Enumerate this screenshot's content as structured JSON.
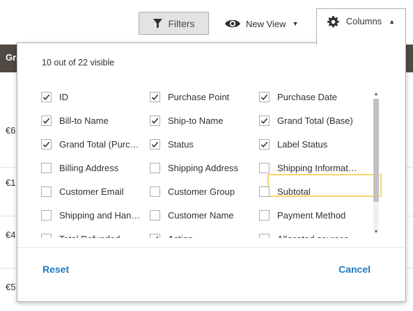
{
  "toolbar": {
    "filters_label": "Filters",
    "view_label": "New View",
    "columns_label": "Columns"
  },
  "grid": {
    "header_label": "Grand T",
    "rows": [
      "€6",
      "€1",
      "€4",
      "€5"
    ]
  },
  "popup": {
    "count_text": "10 out of 22 visible",
    "columns": [
      {
        "label": "ID",
        "checked": true
      },
      {
        "label": "Purchase Point",
        "checked": true
      },
      {
        "label": "Purchase Date",
        "checked": true
      },
      {
        "label": "Bill-to Name",
        "checked": true
      },
      {
        "label": "Ship-to Name",
        "checked": true
      },
      {
        "label": "Grand Total (Base)",
        "checked": true
      },
      {
        "label": "Grand Total (Purc…",
        "checked": true
      },
      {
        "label": "Status",
        "checked": true
      },
      {
        "label": "Label Status",
        "checked": true
      },
      {
        "label": "Billing Address",
        "checked": false
      },
      {
        "label": "Shipping Address",
        "checked": false
      },
      {
        "label": "Shipping Informat…",
        "checked": false
      },
      {
        "label": "Customer Email",
        "checked": false
      },
      {
        "label": "Customer Group",
        "checked": false
      },
      {
        "label": "Subtotal",
        "checked": false
      },
      {
        "label": "Shipping and Han…",
        "checked": false
      },
      {
        "label": "Customer Name",
        "checked": false
      },
      {
        "label": "Payment Method",
        "checked": false
      },
      {
        "label": "Total Refunded",
        "checked": false
      },
      {
        "label": "Action",
        "checked": true
      },
      {
        "label": "Allocated sources",
        "checked": false
      }
    ],
    "reset_label": "Reset",
    "cancel_label": "Cancel"
  },
  "colors": {
    "accent": "#1979c3",
    "header_bg": "#514943",
    "highlight": "#f5d76e"
  }
}
